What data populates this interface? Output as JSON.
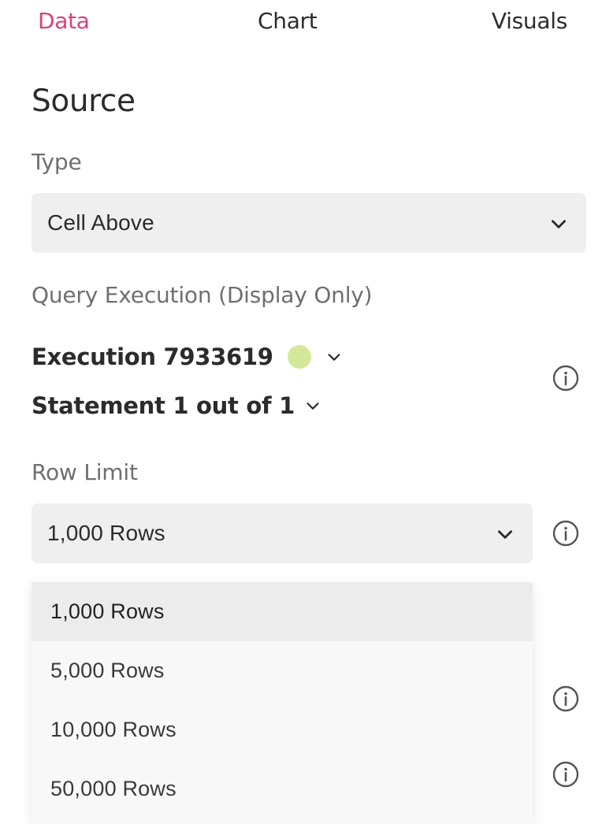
{
  "tabs": {
    "data": "Data",
    "chart": "Chart",
    "visuals": "Visuals"
  },
  "source": {
    "title": "Source",
    "type_label": "Type",
    "type_value": "Cell Above",
    "query_label": "Query Execution (Display Only)",
    "execution": "Execution 7933619",
    "statement": "Statement 1 out of 1",
    "row_limit_label": "Row Limit",
    "row_limit_value": "1,000 Rows"
  },
  "row_limit_options": [
    "1,000 Rows",
    "5,000 Rows",
    "10,000 Rows",
    "50,000 Rows"
  ],
  "colors": {
    "active_tab": "#dd3f7a",
    "status_dot": "#d4e89a"
  },
  "icons": {
    "chevron": "chevron-down-icon",
    "info": "info-icon",
    "status": "status-dot"
  }
}
